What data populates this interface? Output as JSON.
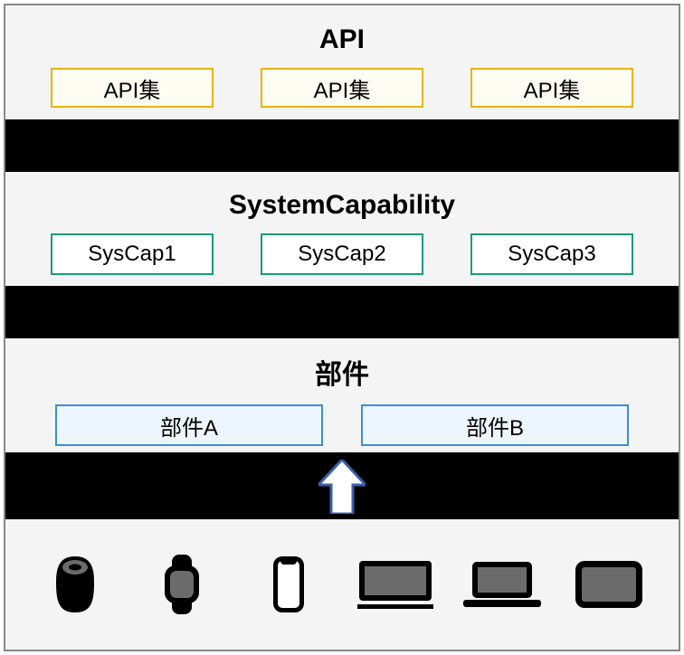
{
  "api_layer": {
    "title": "API",
    "items": [
      "API集",
      "API集",
      "API集"
    ]
  },
  "syscap_layer": {
    "title": "SystemCapability",
    "items": [
      "SysCap1",
      "SysCap2",
      "SysCap3"
    ]
  },
  "part_layer": {
    "title": "部件",
    "items": [
      "部件A",
      "部件B"
    ]
  },
  "devices": [
    "speaker",
    "watch",
    "phone",
    "tv",
    "laptop",
    "tablet"
  ]
}
